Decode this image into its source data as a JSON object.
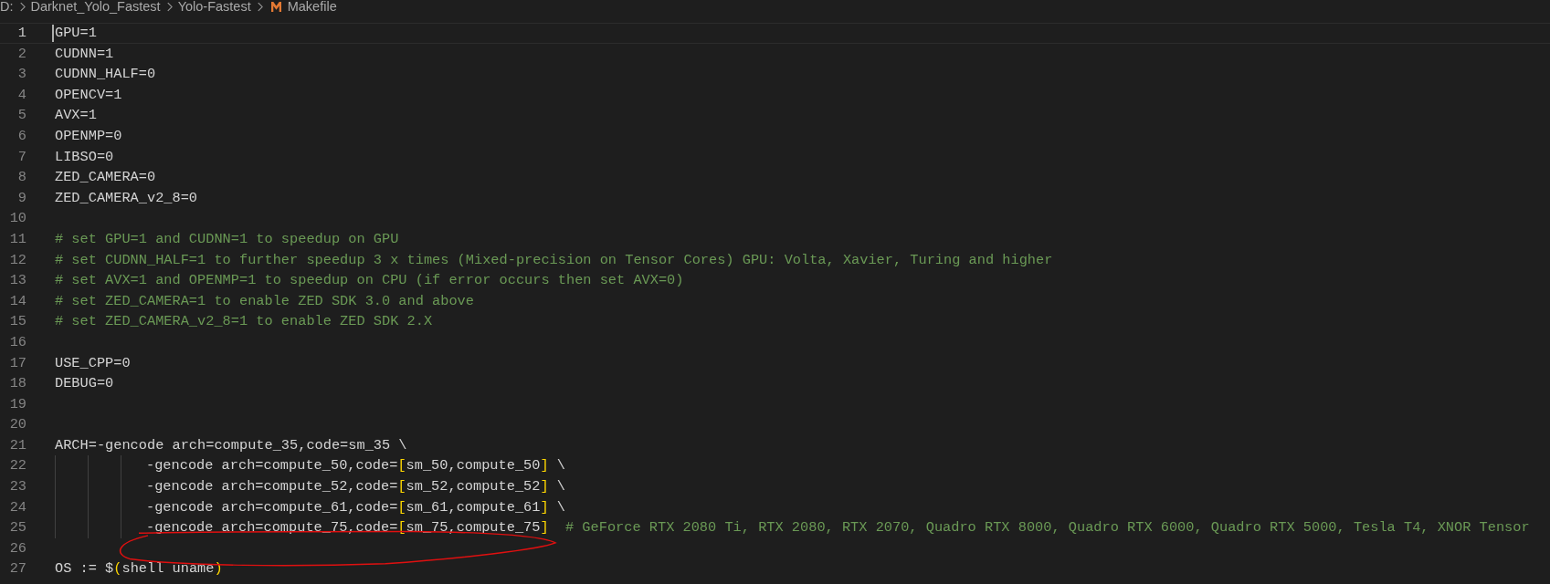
{
  "breadcrumb": [
    {
      "kind": "folder",
      "label": "D:"
    },
    {
      "kind": "folder",
      "label": "Darknet_Yolo_Fastest"
    },
    {
      "kind": "folder",
      "label": "Yolo-Fastest"
    },
    {
      "kind": "file",
      "label": "Makefile"
    }
  ],
  "lines": [
    {
      "number": "1",
      "current": true,
      "tokens": [
        {
          "kind": "text",
          "text": "GPU=1"
        }
      ]
    },
    {
      "number": "2",
      "current": false,
      "tokens": [
        {
          "kind": "text",
          "text": "CUDNN=1"
        }
      ]
    },
    {
      "number": "3",
      "current": false,
      "tokens": [
        {
          "kind": "text",
          "text": "CUDNN_HALF=0"
        }
      ]
    },
    {
      "number": "4",
      "current": false,
      "tokens": [
        {
          "kind": "text",
          "text": "OPENCV=1"
        }
      ]
    },
    {
      "number": "5",
      "current": false,
      "tokens": [
        {
          "kind": "text",
          "text": "AVX=1"
        }
      ]
    },
    {
      "number": "6",
      "current": false,
      "tokens": [
        {
          "kind": "text",
          "text": "OPENMP=0"
        }
      ]
    },
    {
      "number": "7",
      "current": false,
      "tokens": [
        {
          "kind": "text",
          "text": "LIBSO=0"
        }
      ]
    },
    {
      "number": "8",
      "current": false,
      "tokens": [
        {
          "kind": "text",
          "text": "ZED_CAMERA=0"
        }
      ]
    },
    {
      "number": "9",
      "current": false,
      "tokens": [
        {
          "kind": "text",
          "text": "ZED_CAMERA_v2_8=0"
        }
      ]
    },
    {
      "number": "10",
      "current": false
    },
    {
      "number": "11",
      "current": false,
      "tokens": [
        {
          "kind": "comment",
          "text": "# set GPU=1 and CUDNN=1 to speedup on GPU"
        }
      ]
    },
    {
      "number": "12",
      "current": false,
      "tokens": [
        {
          "kind": "comment",
          "text": "# set CUDNN_HALF=1 to further speedup 3 x times (Mixed-precision on Tensor Cores) GPU: Volta, Xavier, Turing and higher"
        }
      ]
    },
    {
      "number": "13",
      "current": false,
      "tokens": [
        {
          "kind": "comment",
          "text": "# set AVX=1 and OPENMP=1 to speedup on CPU (if error occurs then set AVX=0)"
        }
      ]
    },
    {
      "number": "14",
      "current": false,
      "tokens": [
        {
          "kind": "comment",
          "text": "# set ZED_CAMERA=1 to enable ZED SDK 3.0 and above"
        }
      ]
    },
    {
      "number": "15",
      "current": false,
      "tokens": [
        {
          "kind": "comment",
          "text": "# set ZED_CAMERA_v2_8=1 to enable ZED SDK 2.X"
        }
      ]
    },
    {
      "number": "16",
      "current": false
    },
    {
      "number": "17",
      "current": false,
      "tokens": [
        {
          "kind": "text",
          "text": "USE_CPP=0"
        }
      ]
    },
    {
      "number": "18",
      "current": false,
      "tokens": [
        {
          "kind": "text",
          "text": "DEBUG=0"
        }
      ]
    },
    {
      "number": "19",
      "current": false
    },
    {
      "number": "20",
      "current": false
    },
    {
      "number": "21",
      "current": false,
      "tokens": [
        {
          "kind": "text",
          "text": "ARCH=-gencode arch=compute_35,code=sm_35 \\"
        }
      ]
    },
    {
      "number": "22",
      "current": false,
      "indent": true,
      "tokens": [
        {
          "kind": "text",
          "text": "-gencode arch=compute_50,code="
        },
        {
          "kind": "bracket",
          "text": "["
        },
        {
          "kind": "text",
          "text": "sm_50,compute_50"
        },
        {
          "kind": "bracket",
          "text": "]"
        },
        {
          "kind": "text",
          "text": " \\"
        }
      ]
    },
    {
      "number": "23",
      "current": false,
      "indent": true,
      "tokens": [
        {
          "kind": "text",
          "text": "-gencode arch=compute_52,code="
        },
        {
          "kind": "bracket",
          "text": "["
        },
        {
          "kind": "text",
          "text": "sm_52,compute_52"
        },
        {
          "kind": "bracket",
          "text": "]"
        },
        {
          "kind": "text",
          "text": " \\"
        }
      ]
    },
    {
      "number": "24",
      "current": false,
      "indent": true,
      "tokens": [
        {
          "kind": "text",
          "text": "-gencode arch=compute_61,code="
        },
        {
          "kind": "bracket",
          "text": "["
        },
        {
          "kind": "text",
          "text": "sm_61,compute_61"
        },
        {
          "kind": "bracket",
          "text": "]"
        },
        {
          "kind": "text",
          "text": " \\"
        }
      ]
    },
    {
      "number": "25",
      "current": false,
      "indent": true,
      "tokens": [
        {
          "kind": "text",
          "text": "-gencode arch=compute_75,code="
        },
        {
          "kind": "bracket",
          "text": "["
        },
        {
          "kind": "text",
          "text": "sm_75,compute_75"
        },
        {
          "kind": "bracket",
          "text": "]"
        },
        {
          "kind": "comment",
          "text": "  # GeForce RTX 2080 Ti, RTX 2080, RTX 2070, Quadro RTX 8000, Quadro RTX 6000, Quadro RTX 5000, Tesla T4, XNOR Tensor"
        }
      ]
    },
    {
      "number": "26",
      "current": false
    },
    {
      "number": "27",
      "current": false,
      "tokens": [
        {
          "kind": "text",
          "text": "OS := $"
        },
        {
          "kind": "bracket",
          "text": "("
        },
        {
          "kind": "text",
          "text": "shell uname"
        },
        {
          "kind": "bracket",
          "text": ")"
        }
      ]
    }
  ]
}
